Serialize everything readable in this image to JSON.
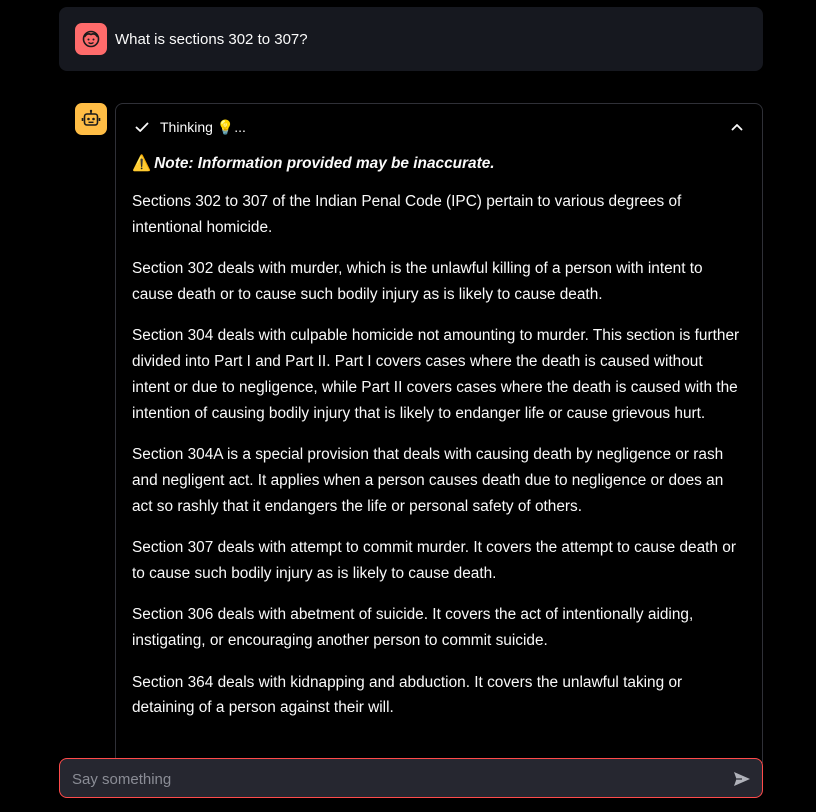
{
  "user_message": {
    "avatar_icon": "user-face-icon",
    "avatar_color": "#ff6b6b",
    "text": "What is sections 302 to 307?"
  },
  "assistant_message": {
    "avatar_icon": "robot-icon",
    "avatar_color": "#ffbd45",
    "expander": {
      "status_icon": "check-icon",
      "title": "Thinking 💡...",
      "expanded": true,
      "toggle_icon": "chevron-up-icon"
    },
    "note": {
      "icon": "⚠️",
      "text": "Note: Information provided may be inaccurate."
    },
    "paragraphs": [
      "Sections 302 to 307 of the Indian Penal Code (IPC) pertain to various degrees of intentional homicide.",
      "Section 302 deals with murder, which is the unlawful killing of a person with intent to cause death or to cause such bodily injury as is likely to cause death.",
      "Section 304 deals with culpable homicide not amounting to murder. This section is further divided into Part I and Part II. Part I covers cases where the death is caused without intent or due to negligence, while Part II covers cases where the death is caused with the intention of causing bodily injury that is likely to endanger life or cause grievous hurt.",
      "Section 304A is a special provision that deals with causing death by negligence or rash and negligent act. It applies when a person causes death due to negligence or does an act so rashly that it endangers the life or personal safety of others.",
      "Section 307 deals with attempt to commit murder. It covers the attempt to cause death or to cause such bodily injury as is likely to cause death.",
      "Section 306 deals with abetment of suicide. It covers the act of intentionally aiding, instigating, or encouraging another person to commit suicide.",
      "Section 364 deals with kidnapping and abduction. It covers the unlawful taking or detaining of a person against their will."
    ]
  },
  "chat_input": {
    "placeholder": "Say something",
    "value": "",
    "border_color": "#ff4b4b",
    "send_icon": "send-icon"
  }
}
